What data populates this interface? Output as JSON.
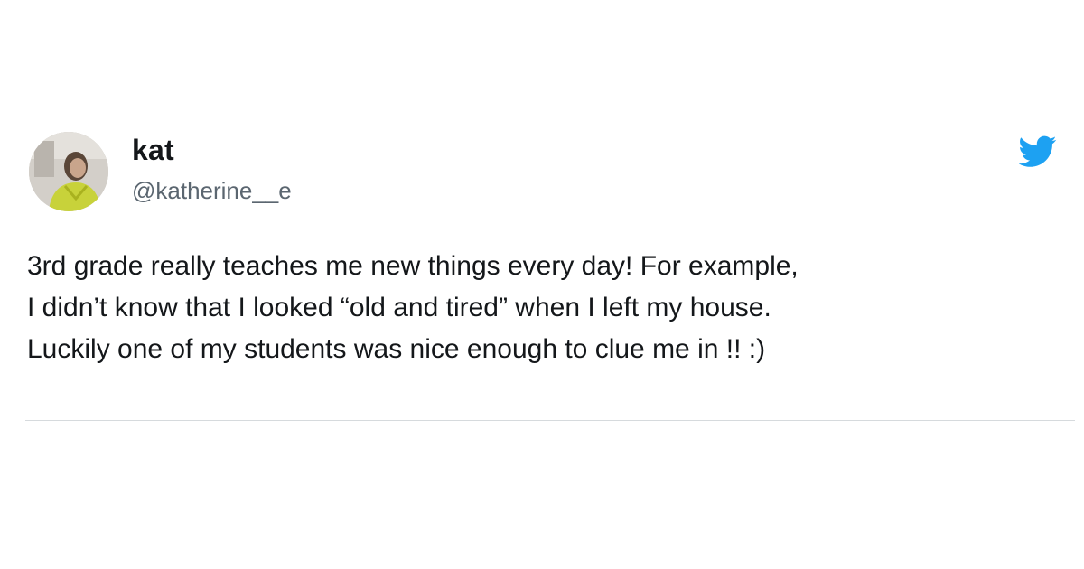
{
  "tweet": {
    "display_name": "kat",
    "handle": "@katherine__e",
    "text_lines": [
      "3rd grade really teaches me new things every day! For example,",
      "I didn’t know that I looked “old and tired” when I left my house.",
      "Luckily one of my students was nice enough to clue me in !! :)"
    ],
    "avatar_icon": "profile-photo",
    "platform_icon": "twitter-bird-icon"
  },
  "colors": {
    "brand": "#1da1f2",
    "text": "#14171a",
    "secondary_text": "#5b6670",
    "divider": "#d6dadd"
  }
}
